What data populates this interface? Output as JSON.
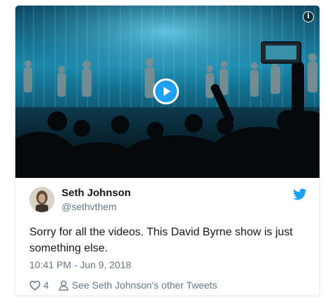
{
  "tweet": {
    "author_name": "Seth Johnson",
    "author_handle": "@sethvthem",
    "text": "Sorry for all the videos. This David Byrne show is just something else.",
    "timestamp": "10:41 PM - Jun 9, 2018",
    "likes": "4",
    "other_tweets_label": "See Seth Johnson's other Tweets"
  },
  "media": {
    "info_icon": "info-icon",
    "play_icon": "play-icon"
  },
  "colors": {
    "accent": "#1da1f2",
    "text": "#14171a",
    "muted": "#657786",
    "border": "#e1e8ed"
  }
}
